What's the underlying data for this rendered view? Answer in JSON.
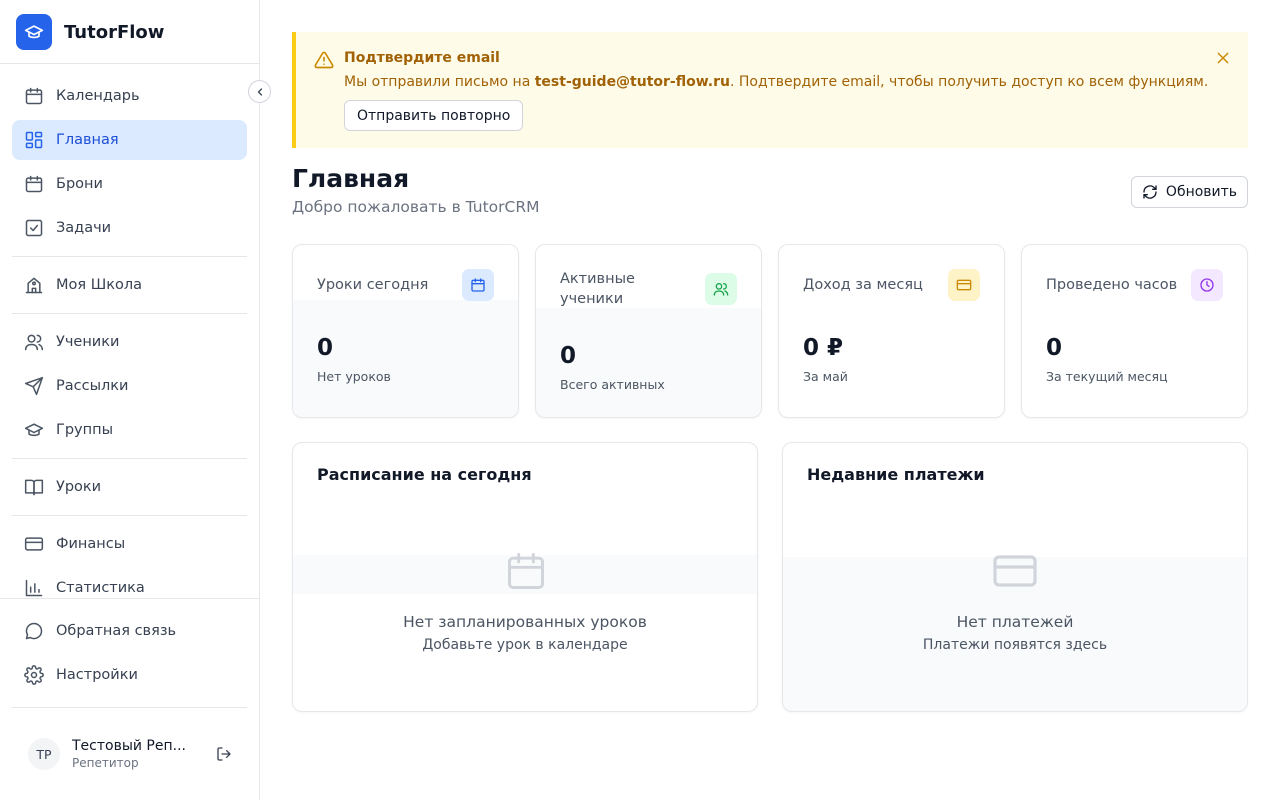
{
  "brand": {
    "name": "TutorFlow",
    "logo_icon": "graduation-cap-icon",
    "accent": "#2563eb"
  },
  "sidebar": {
    "items": [
      {
        "label": "Календарь",
        "icon": "calendar-icon",
        "active": false
      },
      {
        "label": "Главная",
        "icon": "dashboard-icon",
        "active": true
      },
      {
        "label": "Брони",
        "icon": "calendar-icon",
        "active": false
      },
      {
        "label": "Задачи",
        "icon": "checkbox-icon",
        "active": false
      },
      {
        "label": "Моя Школа",
        "icon": "school-icon",
        "active": false
      },
      {
        "label": "Ученики",
        "icon": "users-icon",
        "active": false
      },
      {
        "label": "Рассылки",
        "icon": "send-icon",
        "active": false
      },
      {
        "label": "Группы",
        "icon": "graduation-cap-icon",
        "active": false
      },
      {
        "label": "Уроки",
        "icon": "book-icon",
        "active": false
      },
      {
        "label": "Финансы",
        "icon": "credit-card-icon",
        "active": false
      },
      {
        "label": "Статистика",
        "icon": "bar-chart-icon",
        "active": false
      }
    ],
    "bottom_items": [
      {
        "label": "Обратная связь",
        "icon": "message-circle-icon"
      },
      {
        "label": "Настройки",
        "icon": "gear-icon"
      }
    ],
    "user": {
      "initials": "TP",
      "name": "Тестовый Реп...",
      "role": "Репетитор"
    }
  },
  "alert": {
    "title": "Подтвердите email",
    "text_before": "Мы отправили письмо на ",
    "email": "test-guide@tutor-flow.ru",
    "text_after": ". Подтвердите email, чтобы получить доступ ко всем функциям.",
    "button": "Отправить повторно",
    "color": "#a16207",
    "background": "#fefce8"
  },
  "header": {
    "title": "Главная",
    "subtitle": "Добро пожаловать в TutorCRM",
    "refresh_label": "Обновить"
  },
  "stats": [
    {
      "label": "Уроки сегодня",
      "value": "0",
      "desc": "Нет уроков",
      "icon": "calendar-icon",
      "icon_bg": "#dbeafe",
      "icon_color": "#2563eb"
    },
    {
      "label": "Активные ученики",
      "value": "0",
      "desc": "Всего активных",
      "icon": "users-icon",
      "icon_bg": "#dcfce7",
      "icon_color": "#16a34a"
    },
    {
      "label": "Доход за месяц",
      "value": "0 ₽",
      "desc": "За май",
      "icon": "credit-card-icon",
      "icon_bg": "#fef3c7",
      "icon_color": "#ca8a04"
    },
    {
      "label": "Проведено часов",
      "value": "0",
      "desc": "За текущий месяц",
      "icon": "clock-icon",
      "icon_bg": "#f3e8ff",
      "icon_color": "#9333ea"
    }
  ],
  "schedule": {
    "title": "Расписание на сегодня",
    "empty_title": "Нет запланированных уроков",
    "empty_sub": "Добавьте урок в календаре",
    "icon": "calendar-icon"
  },
  "payments": {
    "title": "Недавние платежи",
    "empty_title": "Нет платежей",
    "empty_sub": "Платежи появятся здесь",
    "icon": "credit-card-icon"
  }
}
